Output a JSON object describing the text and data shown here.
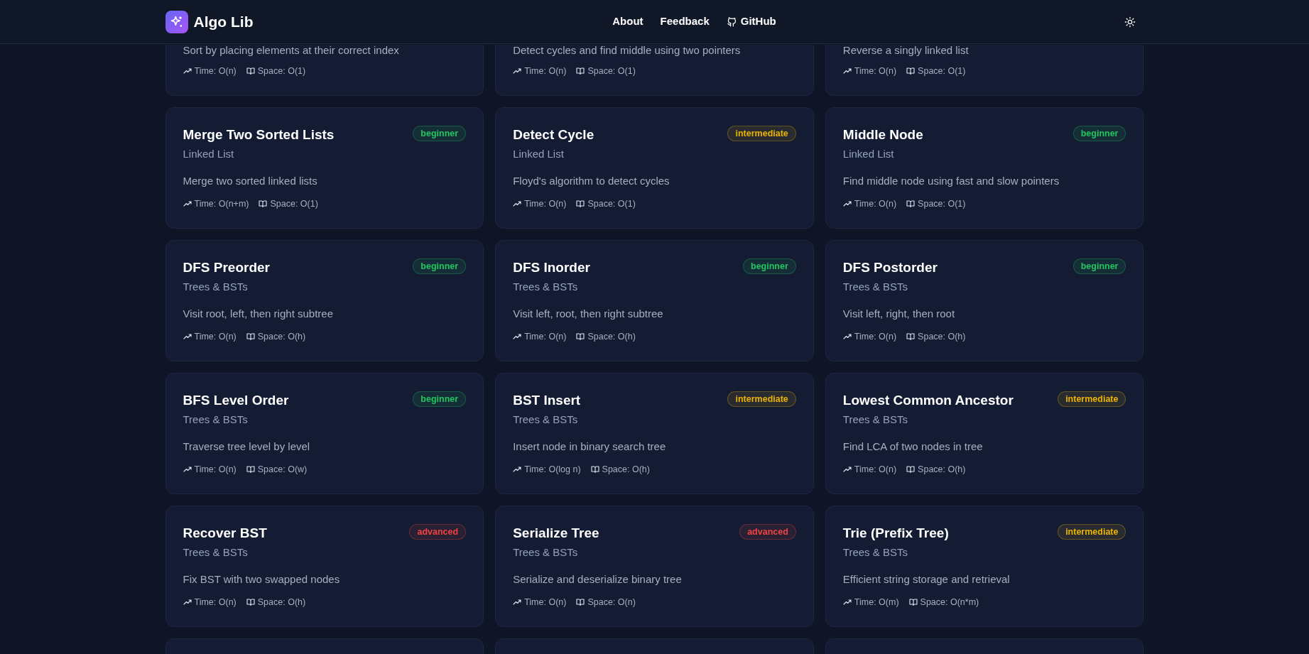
{
  "header": {
    "logo_text": "Algo Lib",
    "nav": [
      {
        "label": "About",
        "kind": "plain"
      },
      {
        "label": "Feedback",
        "kind": "plain"
      },
      {
        "label": "GitHub",
        "kind": "github"
      }
    ]
  },
  "partial_cards": [
    {
      "description": "Sort by placing elements at their correct index",
      "time": "Time: O(n)",
      "space": "Space: O(1)"
    },
    {
      "description": "Detect cycles and find middle using two pointers",
      "time": "Time: O(n)",
      "space": "Space: O(1)"
    },
    {
      "description": "Reverse a singly linked list",
      "time": "Time: O(n)",
      "space": "Space: O(1)"
    }
  ],
  "cards": [
    {
      "title": "Merge Two Sorted Lists",
      "badge": "beginner",
      "kind": "beginner",
      "category": "Linked List",
      "description": "Merge two sorted linked lists",
      "time": "Time: O(n+m)",
      "space": "Space: O(1)"
    },
    {
      "title": "Detect Cycle",
      "badge": "intermediate",
      "kind": "intermediate",
      "category": "Linked List",
      "description": "Floyd's algorithm to detect cycles",
      "time": "Time: O(n)",
      "space": "Space: O(1)"
    },
    {
      "title": "Middle Node",
      "badge": "beginner",
      "kind": "beginner",
      "category": "Linked List",
      "description": "Find middle node using fast and slow pointers",
      "time": "Time: O(n)",
      "space": "Space: O(1)"
    },
    {
      "title": "DFS Preorder",
      "badge": "beginner",
      "kind": "beginner",
      "category": "Trees & BSTs",
      "description": "Visit root, left, then right subtree",
      "time": "Time: O(n)",
      "space": "Space: O(h)"
    },
    {
      "title": "DFS Inorder",
      "badge": "beginner",
      "kind": "beginner",
      "category": "Trees & BSTs",
      "description": "Visit left, root, then right subtree",
      "time": "Time: O(n)",
      "space": "Space: O(h)"
    },
    {
      "title": "DFS Postorder",
      "badge": "beginner",
      "kind": "beginner",
      "category": "Trees & BSTs",
      "description": "Visit left, right, then root",
      "time": "Time: O(n)",
      "space": "Space: O(h)"
    },
    {
      "title": "BFS Level Order",
      "badge": "beginner",
      "kind": "beginner",
      "category": "Trees & BSTs",
      "description": "Traverse tree level by level",
      "time": "Time: O(n)",
      "space": "Space: O(w)"
    },
    {
      "title": "BST Insert",
      "badge": "intermediate",
      "kind": "intermediate",
      "category": "Trees & BSTs",
      "description": "Insert node in binary search tree",
      "time": "Time: O(log n)",
      "space": "Space: O(h)"
    },
    {
      "title": "Lowest Common Ancestor",
      "badge": "intermediate",
      "kind": "intermediate",
      "category": "Trees & BSTs",
      "description": "Find LCA of two nodes in tree",
      "time": "Time: O(n)",
      "space": "Space: O(h)"
    },
    {
      "title": "Recover BST",
      "badge": "advanced",
      "kind": "advanced",
      "category": "Trees & BSTs",
      "description": "Fix BST with two swapped nodes",
      "time": "Time: O(n)",
      "space": "Space: O(h)"
    },
    {
      "title": "Serialize Tree",
      "badge": "advanced",
      "kind": "advanced",
      "category": "Trees & BSTs",
      "description": "Serialize and deserialize binary tree",
      "time": "Time: O(n)",
      "space": "Space: O(n)"
    },
    {
      "title": "Trie (Prefix Tree)",
      "badge": "intermediate",
      "kind": "intermediate",
      "category": "Trees & BSTs",
      "description": "Efficient string storage and retrieval",
      "time": "Time: O(m)",
      "space": "Space: O(n*m)"
    }
  ],
  "next_row": [
    {
      "kind": "card"
    },
    {
      "kind": "card"
    },
    {
      "kind": "card"
    }
  ]
}
